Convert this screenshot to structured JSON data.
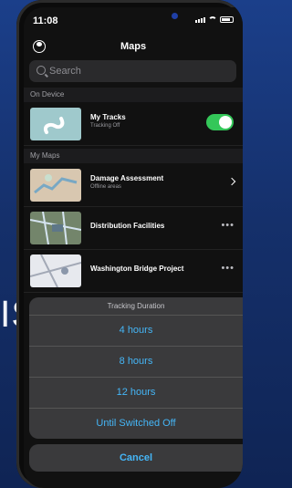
{
  "background_text": "ISS)",
  "status": {
    "time": "11:08"
  },
  "header": {
    "title": "Maps"
  },
  "search": {
    "placeholder": "Search"
  },
  "sections": {
    "on_device": "On Device",
    "my_maps": "My Maps"
  },
  "on_device": {
    "title": "My Tracks",
    "subtitle": "Tracking Off",
    "toggle_on": true
  },
  "maps": [
    {
      "title": "Damage Assessment",
      "subtitle": "Offline areas",
      "action": "chevron-icon"
    },
    {
      "title": "Distribution Facilities",
      "subtitle": "",
      "action": "more-icon"
    },
    {
      "title": "Washington Bridge Project",
      "subtitle": "",
      "action": "more-icon"
    }
  ],
  "sheet": {
    "header": "Tracking Duration",
    "options": [
      "4 hours",
      "8 hours",
      "12 hours",
      "Until Switched Off"
    ],
    "cancel": "Cancel"
  },
  "colors": {
    "accent": "#45b6f7",
    "toggle": "#34c759"
  }
}
